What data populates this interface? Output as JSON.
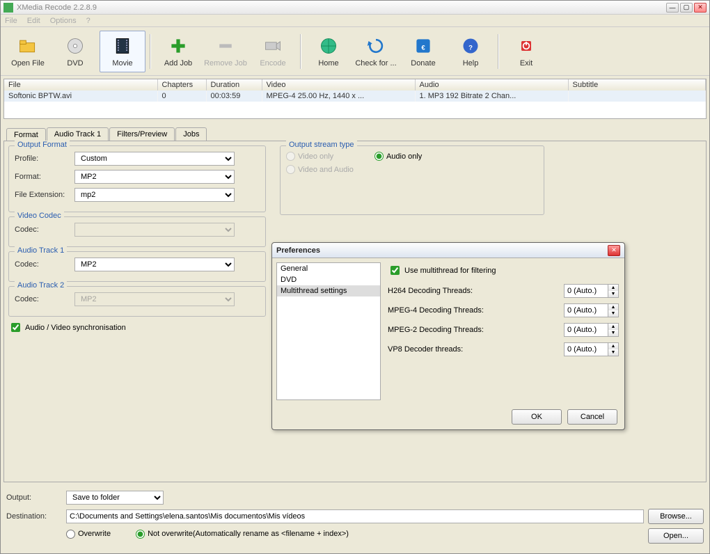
{
  "window": {
    "title": "XMedia Recode 2.2.8.9"
  },
  "menu": {
    "file": "File",
    "edit": "Edit",
    "options": "Options",
    "help": "?"
  },
  "toolbar": {
    "open_file": "Open File",
    "dvd": "DVD",
    "movie": "Movie",
    "add_job": "Add Job",
    "remove_job": "Remove Job",
    "encode": "Encode",
    "home": "Home",
    "check": "Check for ...",
    "donate": "Donate",
    "tb_help": "Help",
    "exit": "Exit"
  },
  "columns": {
    "file": "File",
    "chapters": "Chapters",
    "duration": "Duration",
    "video": "Video",
    "audio": "Audio",
    "subtitle": "Subtitle"
  },
  "rows": [
    {
      "file": "Softonic BPTW.avi",
      "chapters": "0",
      "duration": "00:03:59",
      "video": "MPEG-4 25.00 Hz, 1440 x ...",
      "audio": "1. MP3 192 Bitrate 2 Chan...",
      "subtitle": ""
    }
  ],
  "tabs": {
    "format": "Format",
    "audio1": "Audio Track 1",
    "filters": "Filters/Preview",
    "jobs": "Jobs"
  },
  "output_format": {
    "legend": "Output Format",
    "profile_label": "Profile:",
    "profile_value": "Custom",
    "format_label": "Format:",
    "format_value": "MP2",
    "ext_label": "File Extension:",
    "ext_value": "mp2"
  },
  "output_stream": {
    "legend": "Output stream type",
    "video_only": "Video only",
    "audio_only": "Audio only",
    "va": "Video and Audio"
  },
  "video_codec": {
    "legend": "Video Codec",
    "codec_label": "Codec:",
    "codec_value": ""
  },
  "audio_track1": {
    "legend": "Audio Track 1",
    "codec_label": "Codec:",
    "codec_value": "MP2"
  },
  "audio_track2": {
    "legend": "Audio Track 2",
    "codec_label": "Codec:",
    "codec_value": "MP2"
  },
  "av_sync": "Audio / Video synchronisation",
  "prefs": {
    "title": "Preferences",
    "side": {
      "general": "General",
      "dvd": "DVD",
      "multithread": "Multithread settings"
    },
    "use_mt": "Use multithread for filtering",
    "h264": "H264 Decoding Threads:",
    "mpeg4": "MPEG-4 Decoding Threads:",
    "mpeg2": "MPEG-2 Decoding Threads:",
    "vp8": "VP8 Decoder threads:",
    "auto": "0 (Auto.)",
    "ok": "OK",
    "cancel": "Cancel"
  },
  "bottom": {
    "output_label": "Output:",
    "output_value": "Save to folder",
    "dest_label": "Destination:",
    "dest_value": "C:\\Documents and Settings\\elena.santos\\Mis documentos\\Mis vídeos",
    "browse": "Browse...",
    "open": "Open...",
    "overwrite": "Overwrite",
    "not_overwrite": "Not overwrite(Automatically rename as <filename + index>)"
  }
}
